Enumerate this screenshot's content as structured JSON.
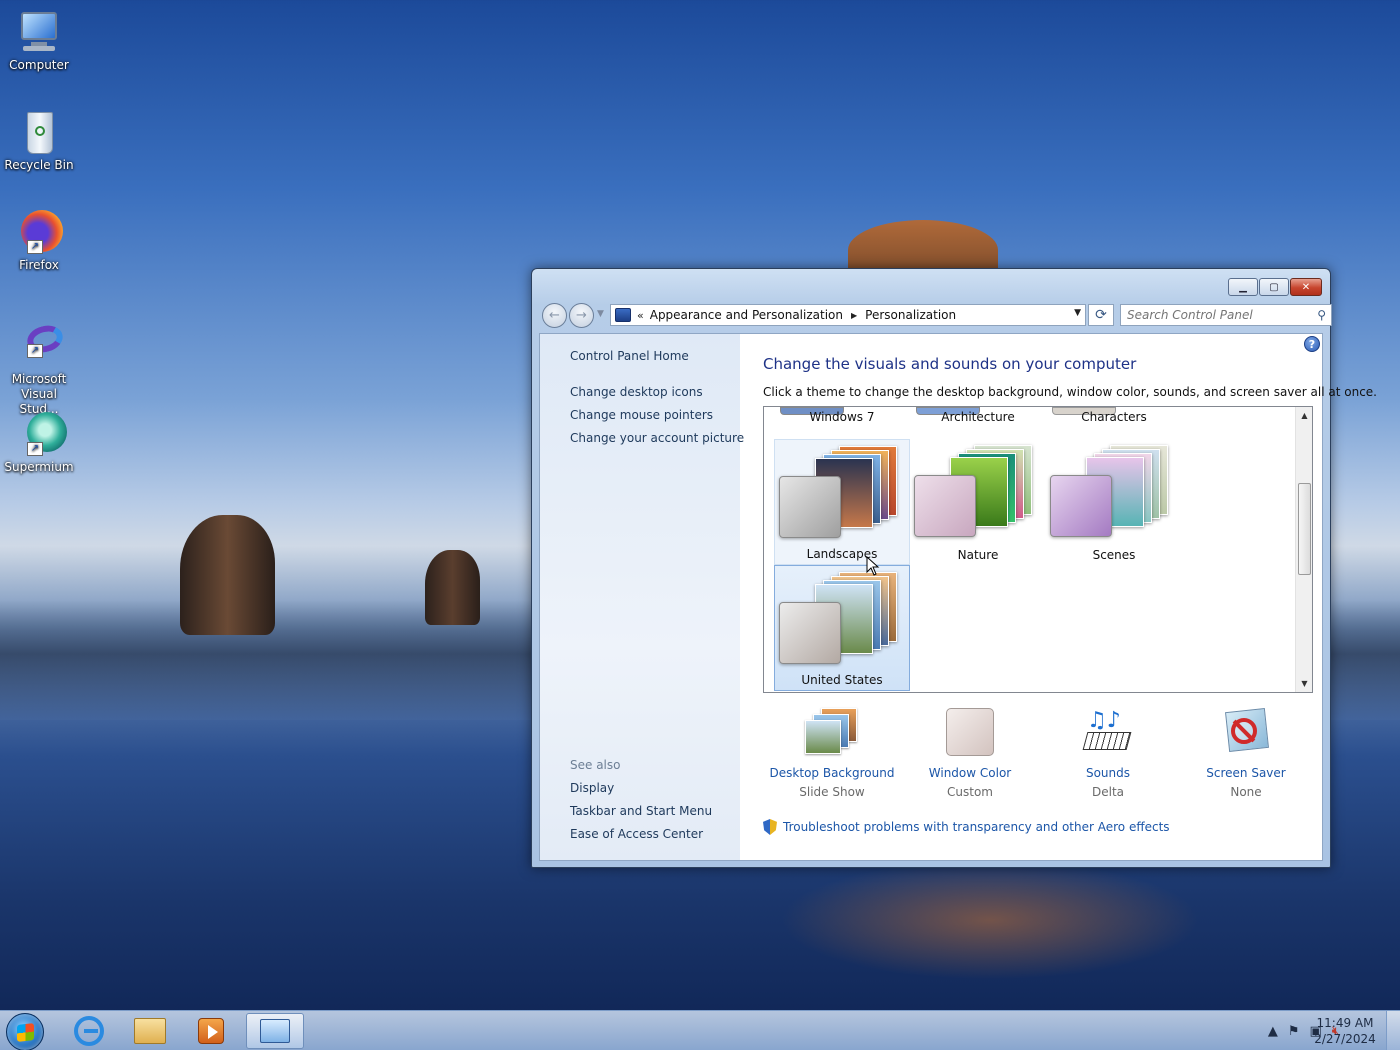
{
  "desktop": {
    "icons": [
      {
        "label": "Computer"
      },
      {
        "label": "Recycle Bin"
      },
      {
        "label": "Firefox"
      },
      {
        "label": "Microsoft Visual Stud..."
      },
      {
        "label": "Supermium"
      }
    ]
  },
  "window": {
    "address": {
      "chevron": "«",
      "crumbs": [
        "Appearance and Personalization",
        "Personalization"
      ]
    },
    "search": {
      "placeholder": "Search Control Panel"
    },
    "left_pane": {
      "home": "Control Panel Home",
      "tasks": [
        "Change desktop icons",
        "Change mouse pointers",
        "Change your account picture"
      ],
      "see_also_heading": "See also",
      "see_also": [
        "Display",
        "Taskbar and Start Menu",
        "Ease of Access Center"
      ]
    },
    "main": {
      "title": "Change the visuals and sounds on your computer",
      "description": "Click a theme to change the desktop background, window color, sounds, and screen saver all at once.",
      "themes": [
        {
          "name": "Windows 7"
        },
        {
          "name": "Architecture"
        },
        {
          "name": "Characters"
        },
        {
          "name": "Landscapes"
        },
        {
          "name": "Nature"
        },
        {
          "name": "Scenes"
        },
        {
          "name": "United States",
          "selected": true
        }
      ],
      "settings": [
        {
          "name": "Desktop Background",
          "value": "Slide Show",
          "icon": "desktop-background-icon"
        },
        {
          "name": "Window Color",
          "value": "Custom",
          "icon": "window-color-icon"
        },
        {
          "name": "Sounds",
          "value": "Delta",
          "icon": "sounds-icon"
        },
        {
          "name": "Screen Saver",
          "value": "None",
          "icon": "screen-saver-icon"
        }
      ],
      "troubleshoot_link": "Troubleshoot problems with transparency and other Aero effects"
    }
  },
  "taskbar": {
    "clock": {
      "time": "11:49 AM",
      "date": "2/27/2024"
    }
  }
}
